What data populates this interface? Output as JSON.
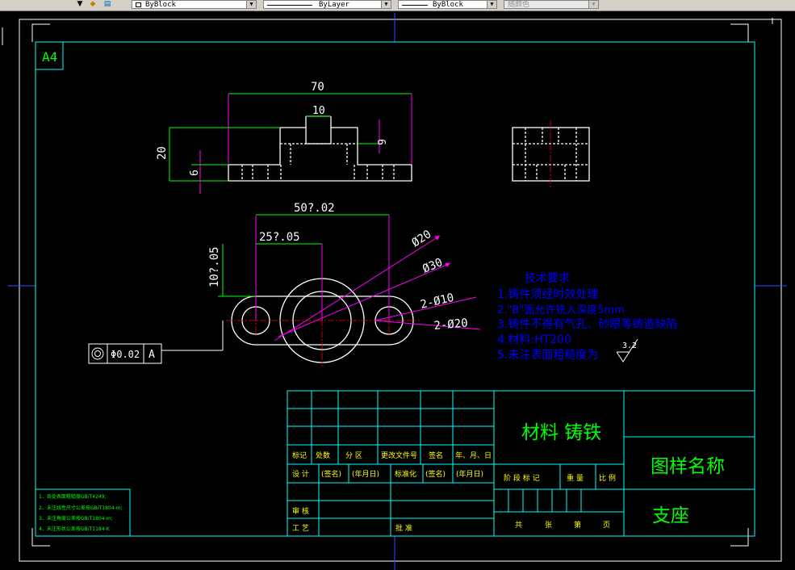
{
  "toolbar": {
    "color_combo": "ByBlock",
    "linetype_combo": "ByLayer",
    "lineweight_combo": "ByBlock",
    "plotstyle_combo": "随颜色"
  },
  "sheet": {
    "size_label": "A4"
  },
  "dimensions": {
    "overall_width": "70",
    "slot_width": "10",
    "height": "20",
    "base_thickness": "6",
    "slot_depth": "6",
    "hole_spacing": "50?.02",
    "half_spacing": "25?.05",
    "vertical_offset": "10?.05",
    "dia_20": "Ø20",
    "dia_30": "Ø30",
    "holes_10": "2-Ø10",
    "holes_20": "2-Ø20"
  },
  "tolerance_frame": {
    "symbol": "◎",
    "value": "Φ0.02",
    "datum": "A"
  },
  "technical_requirements": {
    "title": "技术要求",
    "items": [
      "1.铸件须经时效处理",
      "2.\"B\"面允许铣入深度5mm",
      "3.铸件不得有气孔、砂眼等铸造缺陷",
      "4.材料:HT200",
      "5.未注表面粗糙度为"
    ],
    "roughness_value": "3.2"
  },
  "left_notes": [
    "1、各处表面粗糙度GB/T4249;",
    "2、未注线性尺寸公差按GB/T1804-m;",
    "3、未注角度公差按GB/T1804-m;",
    "4、未注形状公差按GB/T1184-K"
  ],
  "title_block": {
    "material": "材料 铸铁",
    "drawing_name_label": "图样名称",
    "part_name": "支座",
    "revision_headers": [
      "标记",
      "处数",
      "分 区",
      "更改文件号",
      "签名",
      "年、月、日"
    ],
    "design_row": [
      "设 计",
      "(签名)",
      "(年月日)",
      "标准化",
      "(签名)",
      "(年月日)"
    ],
    "stage_headers": [
      "阶 段 标 记",
      "重 量",
      "比 例"
    ],
    "review_label": "审 核",
    "process_label": "工 艺",
    "approve_label": "批 准",
    "sheet_count": [
      "共",
      "张",
      "第",
      "页"
    ]
  },
  "colors": {
    "frame": "#00ffff",
    "outline": "#ffffff",
    "dimension": "#00ff00",
    "dimension_ext": "#ff00ff",
    "tech_text": "#0000ff",
    "title_green": "#00ff00"
  }
}
